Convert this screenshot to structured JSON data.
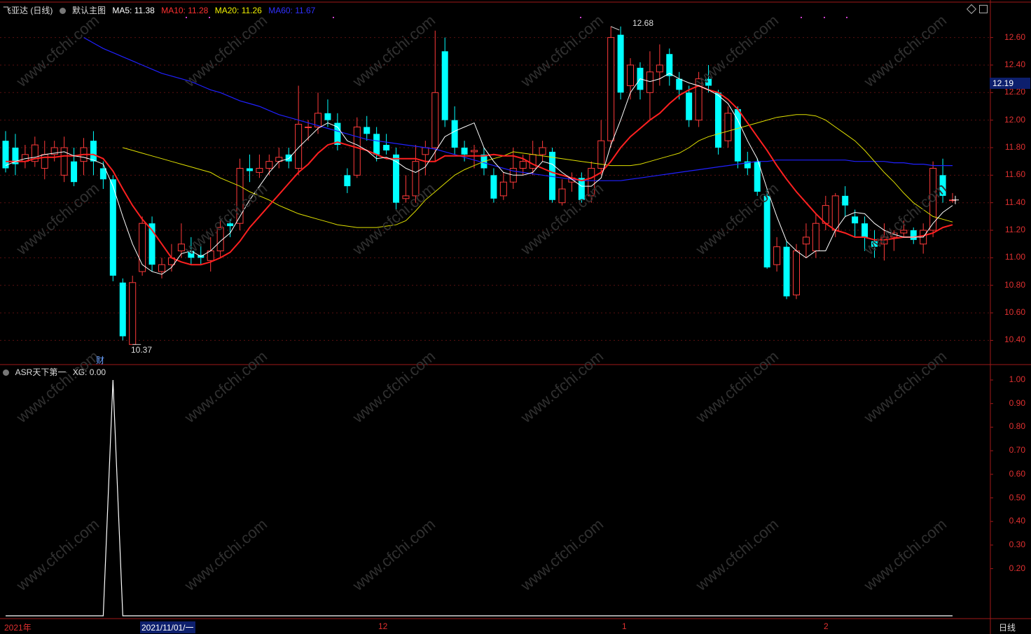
{
  "header": {
    "stock_name": "飞亚达 (日线)",
    "main_chart": "默认主图",
    "ma5": "MA5: 11.38",
    "ma10": "MA10: 11.28",
    "ma20": "MA20: 11.26",
    "ma60": "MA60: 11.67"
  },
  "indicator_header": {
    "name": "ASR天下第一",
    "value": "XG: 0.00"
  },
  "price_axis": [
    "12.60",
    "12.40",
    "12.20",
    "12.00",
    "11.80",
    "11.60",
    "11.40",
    "11.20",
    "11.00",
    "10.80",
    "10.60",
    "10.40"
  ],
  "current_price": "12.19",
  "indicator_axis": [
    "1.00",
    "0.90",
    "0.80",
    "0.70",
    "0.60",
    "0.50",
    "0.40",
    "0.30",
    "0.20"
  ],
  "x_labels": {
    "year": "2021年",
    "date": "2021/11/01/一",
    "m12": "12",
    "m1": "1",
    "m2": "2"
  },
  "period_label": "日线",
  "annotations": {
    "high_label": "12.68",
    "low_label": "10.37",
    "cai_label": "财"
  },
  "watermark": "www.cfchi.com",
  "colors": {
    "up": "#ff3a3a",
    "down": "#00ffff",
    "ma5": "#ffffff",
    "ma10": "#ff2020",
    "ma20": "#e0e000",
    "ma60": "#2020ff"
  },
  "chart_data": {
    "type": "candlestick",
    "ylim": [
      10.27,
      12.72
    ],
    "candles": [
      [
        11.85,
        11.65,
        11.92,
        11.62
      ],
      [
        11.8,
        11.68,
        11.9,
        11.6
      ],
      [
        11.7,
        11.75,
        11.82,
        11.65
      ],
      [
        11.7,
        11.82,
        11.88,
        11.66
      ],
      [
        11.65,
        11.75,
        11.85,
        11.57
      ],
      [
        11.75,
        11.8,
        11.85,
        11.7
      ],
      [
        11.6,
        11.8,
        11.88,
        11.55
      ],
      [
        11.7,
        11.55,
        11.8,
        11.52
      ],
      [
        11.7,
        11.8,
        11.87,
        11.6
      ],
      [
        11.85,
        11.7,
        11.92,
        11.6
      ],
      [
        11.65,
        11.57,
        11.7,
        11.5
      ],
      [
        11.57,
        10.87,
        11.6,
        10.83
      ],
      [
        10.82,
        10.43,
        10.85,
        10.4
      ],
      [
        10.37,
        10.82,
        10.87,
        10.37
      ],
      [
        10.9,
        11.25,
        11.3,
        10.87
      ],
      [
        11.25,
        10.95,
        11.3,
        10.9
      ],
      [
        10.9,
        10.95,
        11.0,
        10.85
      ],
      [
        10.95,
        11.0,
        11.1,
        10.9
      ],
      [
        11.05,
        11.1,
        11.25,
        11.0
      ],
      [
        11.05,
        11.0,
        11.15,
        10.95
      ],
      [
        11.02,
        11.0,
        11.1,
        10.95
      ],
      [
        10.98,
        11.05,
        11.15,
        10.9
      ],
      [
        11.05,
        11.22,
        11.28,
        11.0
      ],
      [
        11.25,
        11.23,
        11.28,
        11.15
      ],
      [
        11.25,
        11.65,
        11.72,
        11.2
      ],
      [
        11.65,
        11.63,
        11.75,
        11.55
      ],
      [
        11.62,
        11.65,
        11.75,
        11.58
      ],
      [
        11.65,
        11.7,
        11.75,
        11.6
      ],
      [
        11.7,
        11.73,
        11.8,
        11.65
      ],
      [
        11.75,
        11.7,
        11.8,
        11.65
      ],
      [
        11.65,
        11.97,
        12.25,
        11.6
      ],
      [
        11.95,
        11.95,
        12.0,
        11.85
      ],
      [
        11.95,
        12.05,
        12.2,
        11.9
      ],
      [
        12.05,
        12.0,
        12.15,
        11.95
      ],
      [
        11.98,
        11.82,
        12.05,
        11.78
      ],
      [
        11.6,
        11.52,
        11.65,
        11.47
      ],
      [
        11.6,
        11.95,
        12.02,
        11.58
      ],
      [
        11.95,
        11.9,
        12.03,
        11.85
      ],
      [
        11.9,
        11.75,
        11.95,
        11.7
      ],
      [
        11.82,
        11.78,
        11.9,
        11.75
      ],
      [
        11.75,
        11.4,
        11.8,
        11.35
      ],
      [
        11.43,
        11.45,
        11.6,
        11.4
      ],
      [
        11.45,
        11.7,
        11.82,
        11.4
      ],
      [
        11.75,
        11.8,
        11.85,
        11.6
      ],
      [
        11.8,
        12.2,
        12.65,
        11.7
      ],
      [
        12.5,
        12.0,
        12.6,
        11.95
      ],
      [
        12.0,
        11.8,
        12.1,
        11.75
      ],
      [
        11.8,
        11.75,
        11.85,
        11.7
      ],
      [
        11.77,
        11.78,
        11.82,
        11.65
      ],
      [
        11.75,
        11.65,
        11.8,
        11.6
      ],
      [
        11.6,
        11.43,
        11.65,
        11.4
      ],
      [
        11.45,
        11.55,
        11.62,
        11.42
      ],
      [
        11.55,
        11.65,
        11.8,
        11.5
      ],
      [
        11.65,
        11.7,
        11.75,
        11.6
      ],
      [
        11.65,
        11.75,
        11.85,
        11.6
      ],
      [
        11.75,
        11.8,
        11.85,
        11.7
      ],
      [
        11.77,
        11.42,
        11.8,
        11.4
      ],
      [
        11.4,
        11.5,
        11.57,
        11.38
      ],
      [
        11.55,
        11.58,
        11.62,
        11.48
      ],
      [
        11.58,
        11.42,
        11.62,
        11.4
      ],
      [
        11.45,
        11.65,
        11.7,
        11.4
      ],
      [
        11.65,
        11.85,
        12.0,
        11.6
      ],
      [
        11.85,
        12.6,
        12.68,
        11.8
      ],
      [
        12.62,
        12.2,
        12.68,
        12.15
      ],
      [
        12.25,
        12.4,
        12.45,
        12.15
      ],
      [
        12.38,
        12.22,
        12.42,
        12.15
      ],
      [
        12.2,
        12.35,
        12.5,
        12.0
      ],
      [
        12.35,
        12.4,
        12.55,
        12.25
      ],
      [
        12.48,
        12.32,
        12.52,
        12.25
      ],
      [
        12.3,
        12.22,
        12.35,
        12.15
      ],
      [
        12.2,
        12.0,
        12.25,
        11.95
      ],
      [
        12.0,
        12.3,
        12.35,
        11.95
      ],
      [
        12.3,
        12.25,
        12.4,
        12.2
      ],
      [
        12.2,
        11.8,
        12.22,
        11.75
      ],
      [
        11.85,
        12.05,
        12.1,
        11.8
      ],
      [
        12.08,
        11.7,
        12.1,
        11.65
      ],
      [
        11.7,
        11.65,
        11.77,
        11.6
      ],
      [
        11.7,
        11.48,
        11.72,
        11.45
      ],
      [
        11.45,
        10.93,
        11.5,
        10.92
      ],
      [
        10.95,
        11.08,
        11.15,
        10.9
      ],
      [
        11.08,
        10.72,
        11.12,
        10.7
      ],
      [
        10.73,
        11.05,
        11.1,
        10.7
      ],
      [
        11.1,
        11.15,
        11.25,
        11.0
      ],
      [
        11.05,
        11.25,
        11.32,
        11.0
      ],
      [
        11.25,
        11.38,
        11.45,
        11.2
      ],
      [
        11.2,
        11.45,
        11.47,
        11.15
      ],
      [
        11.45,
        11.38,
        11.52,
        11.3
      ],
      [
        11.3,
        11.25,
        11.35,
        11.15
      ],
      [
        11.25,
        11.15,
        11.3,
        11.05
      ],
      [
        11.12,
        11.08,
        11.2,
        11.0
      ],
      [
        11.1,
        11.15,
        11.25,
        10.98
      ],
      [
        11.15,
        11.18,
        11.2,
        11.05
      ],
      [
        11.18,
        11.2,
        11.27,
        11.15
      ],
      [
        11.2,
        11.13,
        11.22,
        11.1
      ],
      [
        11.1,
        11.2,
        11.25,
        11.03
      ],
      [
        11.2,
        11.65,
        11.7,
        11.15
      ],
      [
        11.6,
        11.45,
        11.72,
        11.4
      ],
      [
        11.42,
        11.42,
        11.47,
        11.4
      ]
    ],
    "ma5": [
      11.67,
      11.7,
      11.72,
      11.73,
      11.75,
      11.76,
      11.77,
      11.74,
      11.73,
      11.71,
      11.68,
      11.52,
      11.3,
      11.1,
      10.95,
      10.9,
      10.88,
      10.93,
      11.03,
      11.05,
      11.01,
      11.05,
      11.12,
      11.18,
      11.3,
      11.42,
      11.52,
      11.62,
      11.7,
      11.72,
      11.8,
      11.87,
      11.94,
      11.98,
      11.95,
      11.85,
      11.82,
      11.78,
      11.72,
      11.73,
      11.7,
      11.65,
      11.62,
      11.66,
      11.77,
      11.88,
      11.92,
      11.95,
      11.98,
      11.8,
      11.7,
      11.62,
      11.6,
      11.6,
      11.62,
      11.7,
      11.68,
      11.62,
      11.57,
      11.52,
      11.52,
      11.58,
      11.82,
      12.0,
      12.2,
      12.3,
      12.28,
      12.3,
      12.34,
      12.3,
      12.27,
      12.25,
      12.22,
      12.18,
      12.12,
      12.0,
      11.85,
      11.72,
      11.5,
      11.3,
      11.12,
      11.05,
      11.0,
      11.05,
      11.05,
      11.2,
      11.3,
      11.33,
      11.32,
      11.25,
      11.2,
      11.17,
      11.15,
      11.15,
      11.15,
      11.25,
      11.33,
      11.38
    ],
    "ma10": [
      11.7,
      11.7,
      11.7,
      11.72,
      11.73,
      11.73,
      11.74,
      11.74,
      11.75,
      11.75,
      11.72,
      11.63,
      11.5,
      11.38,
      11.28,
      11.2,
      11.1,
      11.0,
      10.97,
      10.95,
      10.95,
      10.97,
      11.0,
      11.04,
      11.12,
      11.22,
      11.3,
      11.38,
      11.46,
      11.54,
      11.62,
      11.68,
      11.76,
      11.82,
      11.84,
      11.82,
      11.8,
      11.78,
      11.75,
      11.72,
      11.72,
      11.72,
      11.72,
      11.7,
      11.7,
      11.74,
      11.74,
      11.74,
      11.74,
      11.74,
      11.75,
      11.74,
      11.74,
      11.72,
      11.68,
      11.65,
      11.62,
      11.6,
      11.58,
      11.56,
      11.58,
      11.62,
      11.7,
      11.8,
      11.88,
      11.94,
      12.0,
      12.05,
      12.12,
      12.18,
      12.22,
      12.25,
      12.22,
      12.2,
      12.15,
      12.08,
      11.98,
      11.88,
      11.78,
      11.67,
      11.57,
      11.48,
      11.4,
      11.32,
      11.25,
      11.2,
      11.18,
      11.15,
      11.15,
      11.13,
      11.13,
      11.14,
      11.15,
      11.15,
      11.16,
      11.18,
      11.22,
      11.24
    ],
    "ma20": [
      11.8,
      11.78,
      11.76,
      11.74,
      11.72,
      11.7,
      11.68,
      11.66,
      11.64,
      11.62,
      11.58,
      11.55,
      11.52,
      11.48,
      11.45,
      11.42,
      11.38,
      11.35,
      11.32,
      11.3,
      11.28,
      11.26,
      11.24,
      11.23,
      11.22,
      11.22,
      11.22,
      11.23,
      11.24,
      11.27,
      11.34,
      11.42,
      11.48,
      11.54,
      11.6,
      11.64,
      11.67,
      11.7,
      11.72,
      11.74,
      11.77,
      11.76,
      11.75,
      11.74,
      11.73,
      11.72,
      11.71,
      11.7,
      11.69,
      11.68,
      11.67,
      11.67,
      11.67,
      11.68,
      11.7,
      11.72,
      11.74,
      11.76,
      11.8,
      11.85,
      11.88,
      11.9,
      11.92,
      11.94,
      11.96,
      11.98,
      12.0,
      12.02,
      12.03,
      12.04,
      12.04,
      12.03,
      12.0,
      11.95,
      11.9,
      11.85,
      11.78,
      11.7,
      11.62,
      11.55,
      11.47,
      11.4,
      11.35,
      11.3,
      11.28,
      11.26
    ],
    "ma60": [
      12.6,
      12.56,
      12.52,
      12.49,
      12.46,
      12.43,
      12.4,
      12.37,
      12.34,
      12.32,
      12.3,
      12.28,
      12.25,
      12.22,
      12.2,
      12.17,
      12.14,
      12.12,
      12.1,
      12.07,
      12.04,
      12.02,
      12.0,
      11.98,
      11.96,
      11.94,
      11.92,
      11.9,
      11.88,
      11.86,
      11.85,
      11.84,
      11.83,
      11.82,
      11.81,
      11.8,
      11.79,
      11.77,
      11.75,
      11.73,
      11.71,
      11.69,
      11.67,
      11.65,
      11.63,
      11.62,
      11.61,
      11.6,
      11.59,
      11.58,
      11.57,
      11.56,
      11.56,
      11.56,
      11.56,
      11.56,
      11.57,
      11.58,
      11.59,
      11.6,
      11.61,
      11.62,
      11.63,
      11.64,
      11.65,
      11.66,
      11.67,
      11.68,
      11.69,
      11.7,
      11.7,
      11.71,
      11.71,
      11.71,
      11.71,
      11.71,
      11.71,
      11.71,
      11.71,
      11.7,
      11.7,
      11.7,
      11.7,
      11.69,
      11.69,
      11.68,
      11.68,
      11.67,
      11.67,
      11.67
    ],
    "indicator": {
      "name": "XG",
      "spike_index": 11,
      "ylim": [
        0,
        1
      ]
    }
  }
}
